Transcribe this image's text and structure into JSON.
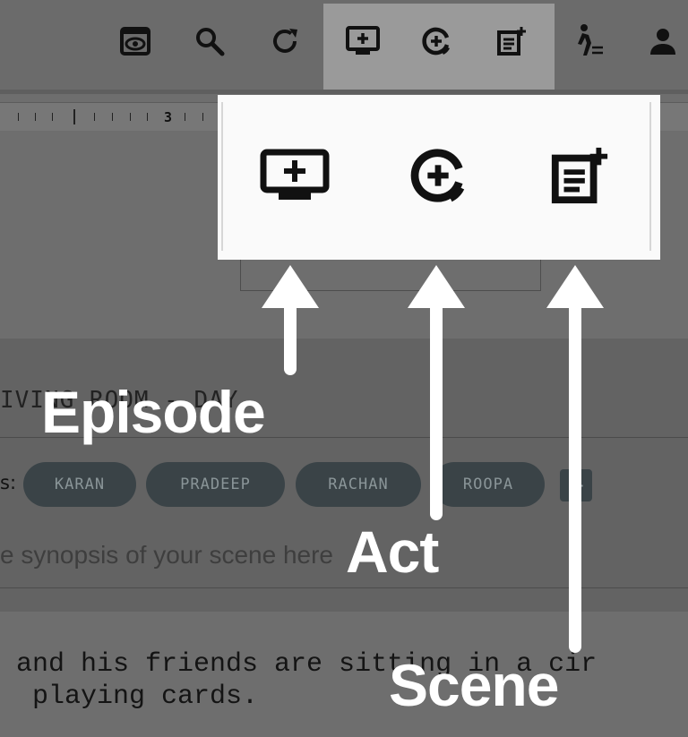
{
  "toolbar": {
    "icons": [
      "preview-icon",
      "search-icon",
      "refresh-icon",
      "add-episode-icon",
      "add-act-icon",
      "add-scene-icon",
      "character-list-icon",
      "account-icon"
    ]
  },
  "ruler": {
    "number": "3"
  },
  "scene": {
    "slugline": "IVING ROOM - DAY",
    "characters_label": "s:",
    "characters": [
      "KARAN",
      "PRADEEP",
      "RACHAN",
      "ROOPA"
    ],
    "add_character_glyph": "+",
    "synopsis_placeholder": "e synopsis of your scene here",
    "action_line1": " and his friends are sitting in a cir",
    "action_line2": "  playing cards."
  },
  "popup": {
    "icons": [
      "add-episode-icon",
      "add-act-icon",
      "add-scene-icon"
    ]
  },
  "annotations": {
    "episode": "Episode",
    "act": "Act",
    "scene": "Scene"
  },
  "colors": {
    "overlay": "#6e6e6e",
    "highlight": "#9a9a9a",
    "popup_bg": "#fafafa",
    "chip_bg": "#3a4347",
    "annotation": "#ffffff"
  }
}
